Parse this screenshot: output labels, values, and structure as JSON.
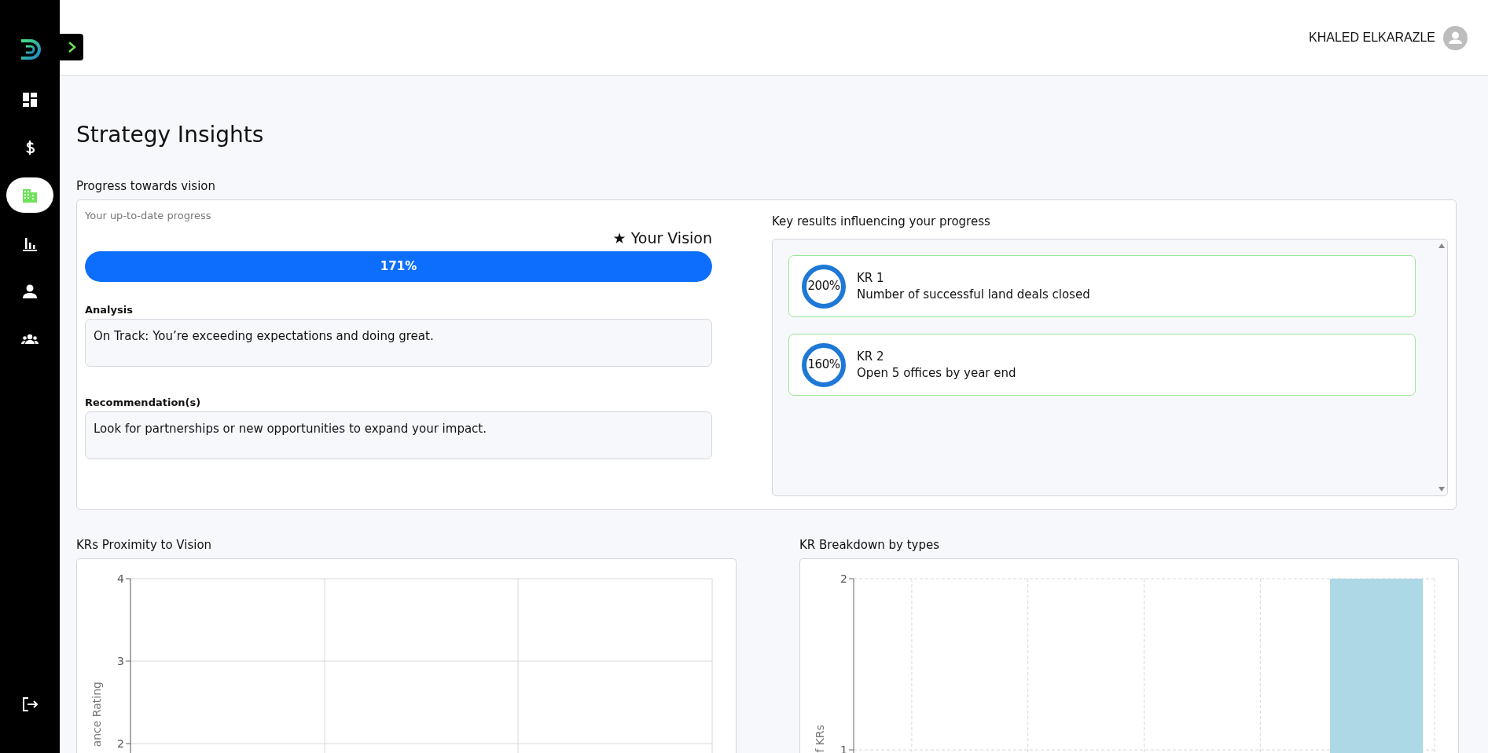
{
  "sidebar": {
    "items": [
      {
        "selected": false
      },
      {
        "selected": false
      },
      {
        "selected": true
      },
      {
        "selected": false
      },
      {
        "selected": false
      },
      {
        "selected": false
      }
    ]
  },
  "header": {
    "user_name": "KHALED ELKARAZLE"
  },
  "page_title": "Strategy Insights",
  "progress_section": {
    "title": "Progress towards vision",
    "subtitle": "Your up-to-date progress",
    "vision_label": "★ Your Vision",
    "progress": {
      "level": 1,
      "reading": "171%"
    },
    "analysis": {
      "label": "Analysis",
      "text": "On Track: You’re exceeding expectations and doing great."
    },
    "recommendation": {
      "label": "Recommendation(s)",
      "text": "Look for partnerships or new opportunities to expand your impact."
    }
  },
  "key_results": {
    "title": "Key results influencing your progress",
    "items": [
      {
        "name": "KR 1",
        "description": "Number of successful land deals closed",
        "reading": "200%",
        "level": 1
      },
      {
        "name": "KR 2",
        "description": "Open 5 offices by year end",
        "reading": "160%",
        "level": 1
      }
    ]
  },
  "charts": [
    {
      "title": "KRs Proximity to Vision",
      "plot": {
        "y_axis_label": "ance Rating",
        "y_tick_labels": [
          "4",
          "3",
          "2"
        ]
      }
    },
    {
      "title": "KR Breakdown by types",
      "chart_data": {
        "type": "bar",
        "categories": [
          null,
          null,
          null,
          null,
          null
        ],
        "ylabel": "f KRs",
        "ylim": [
          0,
          2
        ],
        "yticks": [
          1,
          2
        ],
        "grid": true,
        "series": [
          {
            "color": "#add8e6",
            "values": [
              0,
              0,
              0,
              0,
              2
            ]
          }
        ]
      }
    }
  ]
}
